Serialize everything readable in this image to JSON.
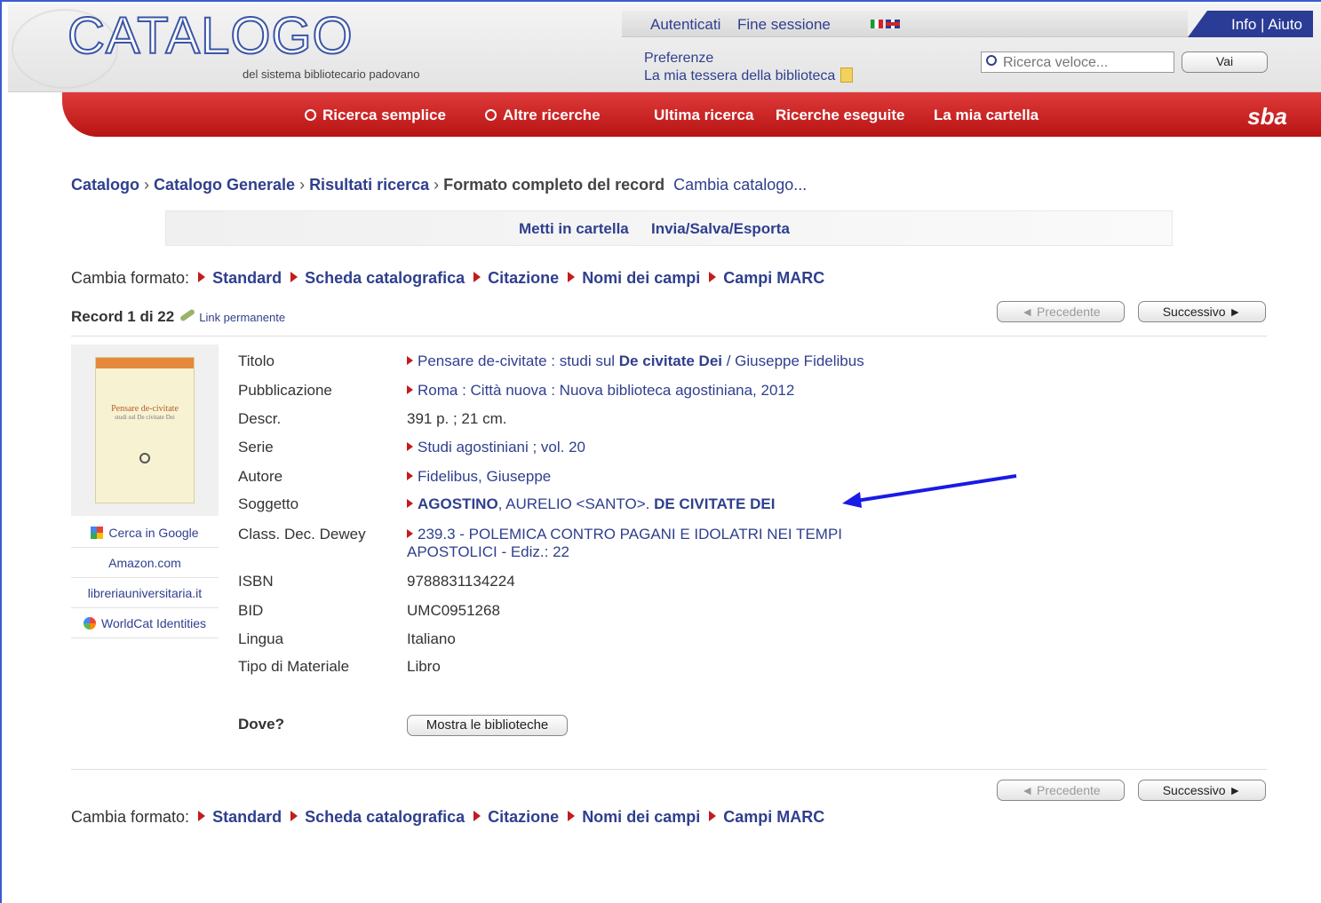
{
  "header": {
    "logo": "CATALOGO",
    "subtitle": "del sistema bibliotecario padovano",
    "login": "Autenticati",
    "logout": "Fine sessione",
    "info": "Info | Aiuto",
    "preferences": "Preferenze",
    "library_card": "La mia tessera della biblioteca",
    "quick_search_placeholder": "Ricerca veloce...",
    "go": "Vai"
  },
  "nav": {
    "simple_search": "Ricerca semplice",
    "other_searches": "Altre ricerche",
    "last_search": "Ultima ricerca",
    "searches_done": "Ricerche eseguite",
    "my_folder": "La mia cartella",
    "brand": "sba"
  },
  "breadcrumb": {
    "catalog": "Catalogo",
    "general": "Catalogo Generale",
    "results": "Risultati ricerca",
    "current": "Formato completo del record",
    "change": "Cambia catalogo..."
  },
  "actions": {
    "add_folder": "Metti in cartella",
    "send": "Invia/Salva/Esporta"
  },
  "formats": {
    "label": "Cambia formato:",
    "items": [
      "Standard",
      "Scheda catalografica",
      "Citazione",
      "Nomi dei campi",
      "Campi MARC"
    ]
  },
  "record": {
    "position": "Record 1 di 22",
    "permalink": "Link permanente",
    "prev": "◄ Precedente",
    "next": "Successivo ►"
  },
  "book_cover": {
    "title": "Pensare de-civitate"
  },
  "side_links": [
    "Cerca in Google",
    "Amazon.com",
    "libreriauniversitaria.it",
    "WorldCat Identities"
  ],
  "fields": {
    "titolo": {
      "label": "Titolo",
      "pre": "Pensare de-civitate : studi sul ",
      "bold": "De civitate Dei",
      "post": " / Giuseppe Fidelibus"
    },
    "pubblicazione": {
      "label": "Pubblicazione",
      "value": "Roma : Città nuova : Nuova biblioteca agostiniana, 2012"
    },
    "descr": {
      "label": "Descr.",
      "value": "391 p. ; 21 cm."
    },
    "serie": {
      "label": "Serie",
      "value": "Studi agostiniani ; vol. 20"
    },
    "autore": {
      "label": "Autore",
      "value": "Fidelibus, Giuseppe"
    },
    "soggetto": {
      "label": "Soggetto",
      "b1": "AGOSTINO",
      "mid": ", AURELIO <SANTO>. ",
      "b2": "DE CIVITATE DEI"
    },
    "dewey": {
      "label": "Class. Dec. Dewey",
      "line1": "239.3 - POLEMICA CONTRO PAGANI E IDOLATRI NEI TEMPI",
      "line2": "APOSTOLICI - Ediz.: 22"
    },
    "isbn": {
      "label": "ISBN",
      "value": "9788831134224"
    },
    "bid": {
      "label": "BID",
      "value": "UMC0951268"
    },
    "lingua": {
      "label": "Lingua",
      "value": "Italiano"
    },
    "tipo": {
      "label": "Tipo di Materiale",
      "value": "Libro"
    },
    "dove": {
      "label": "Dove?",
      "button": "Mostra le biblioteche"
    }
  },
  "colors": {
    "brand_blue": "#2f3f8e",
    "nav_red": "#c41b1b",
    "annotation_arrow": "#1a1ae6"
  }
}
